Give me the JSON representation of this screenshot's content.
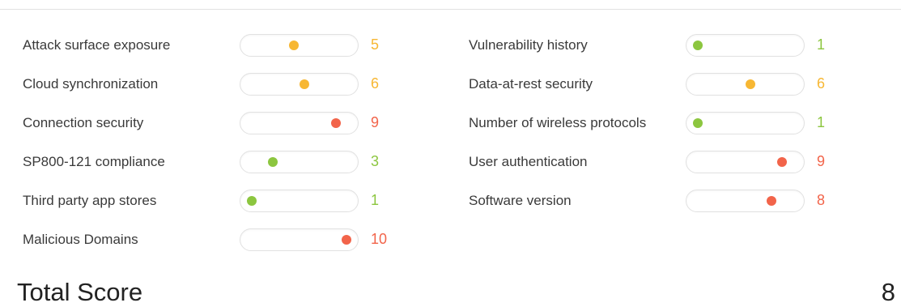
{
  "colors": {
    "low": "#8cc63f",
    "medium": "#f7b733",
    "high": "#f2644a"
  },
  "scale": {
    "min": 1,
    "max": 10
  },
  "metrics_left": [
    {
      "label": "Attack surface exposure",
      "value": "5",
      "level": "medium"
    },
    {
      "label": "Cloud synchronization",
      "value": "6",
      "level": "medium"
    },
    {
      "label": "Connection security",
      "value": "9",
      "level": "high"
    },
    {
      "label": "SP800-121 compliance",
      "value": "3",
      "level": "low"
    },
    {
      "label": "Third party app stores",
      "value": "1",
      "level": "low"
    },
    {
      "label": "Malicious Domains",
      "value": "10",
      "level": "high"
    }
  ],
  "metrics_right": [
    {
      "label": "Vulnerability history",
      "value": "1",
      "level": "low"
    },
    {
      "label": "Data-at-rest security",
      "value": "6",
      "level": "medium"
    },
    {
      "label": "Number of wireless protocols",
      "value": "1",
      "level": "low"
    },
    {
      "label": "User authentication",
      "value": "9",
      "level": "high"
    },
    {
      "label": "Software version",
      "value": "8",
      "level": "high"
    }
  ],
  "total": {
    "label": "Total Score",
    "value": "8"
  }
}
